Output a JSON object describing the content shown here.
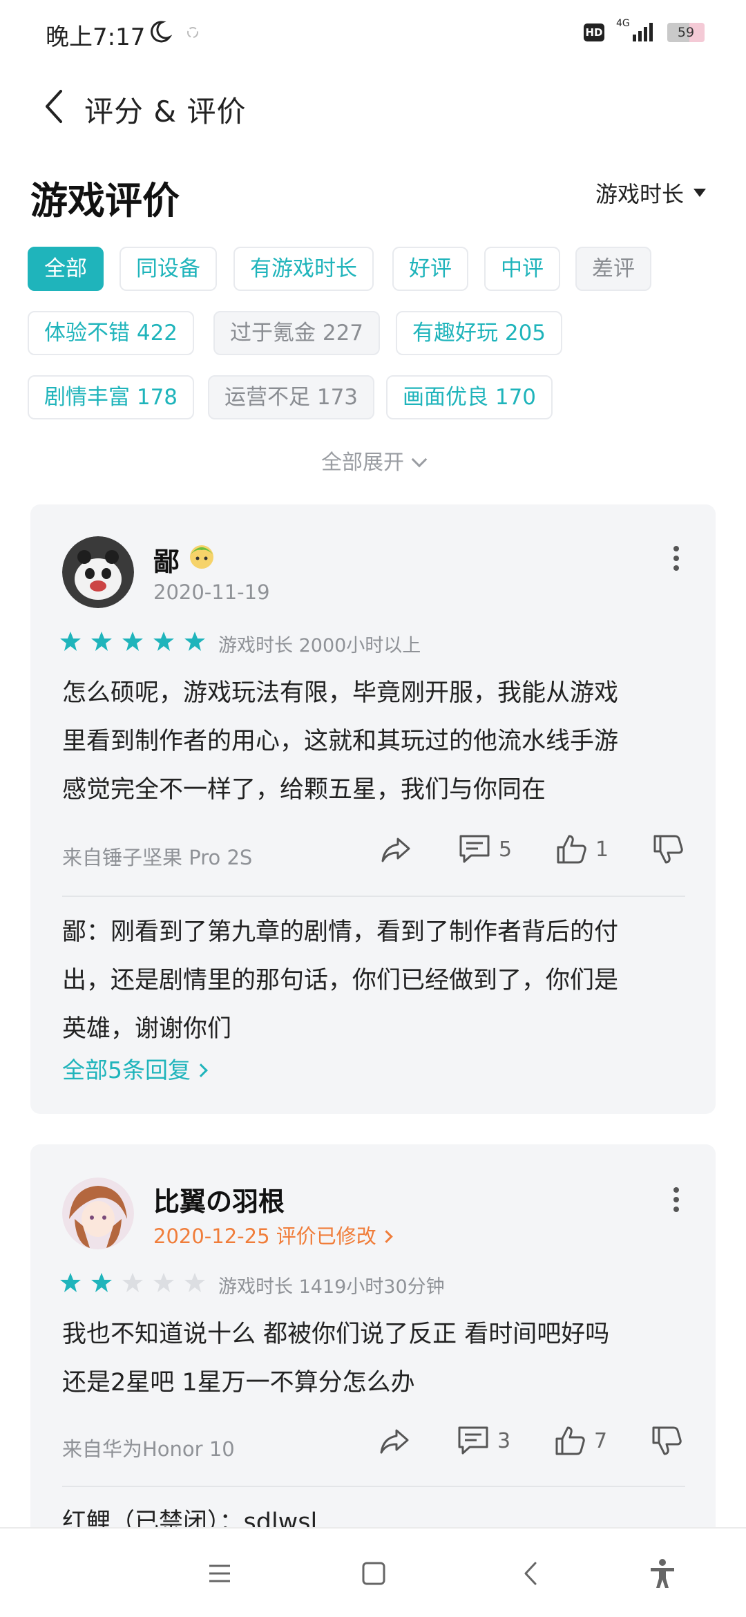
{
  "status_bar": {
    "time": "晚上7:17",
    "hd": "HD",
    "network": "4G",
    "battery": "59"
  },
  "header": {
    "title": "评分 & 评价"
  },
  "section": {
    "title": "游戏评价",
    "sort_label": "游戏时长"
  },
  "filters": [
    {
      "label": "全部",
      "state": "active"
    },
    {
      "label": "同设备",
      "state": "normal"
    },
    {
      "label": "有游戏时长",
      "state": "normal"
    },
    {
      "label": "好评",
      "state": "normal"
    },
    {
      "label": "中评",
      "state": "normal"
    },
    {
      "label": "差评",
      "state": "neg"
    },
    {
      "label": "体验不错 422",
      "state": "normal"
    },
    {
      "label": "过于氪金 227",
      "state": "neg"
    },
    {
      "label": "有趣好玩 205",
      "state": "normal"
    },
    {
      "label": "剧情丰富 178",
      "state": "normal"
    },
    {
      "label": "运营不足 173",
      "state": "neg"
    },
    {
      "label": "画面优良 170",
      "state": "normal"
    }
  ],
  "expand_all": "全部展开",
  "reviews": [
    {
      "user": "鄙",
      "date": "2020-11-19",
      "rating": 5,
      "playtime": "游戏时长 2000小时以上",
      "body_lines": [
        "怎么硕呢，游戏玩法有限，毕竟刚开服，我能从游戏",
        "里看到制作者的用心，这就和其玩过的他流水线手游",
        "感觉完全不一样了，给颗五星，我们与你同在"
      ],
      "source": "来自锤子坚果 Pro 2S",
      "comments": "5",
      "likes": "1",
      "reply_lines": [
        "鄙：刚看到了第九章的剧情，看到了制作者背后的付",
        "出，还是剧情里的那句话，你们已经做到了，你们是",
        "英雄，谢谢你们"
      ],
      "all_replies": "全部5条回复"
    },
    {
      "user": "比翼の羽根",
      "date": "2020-12-25 评价已修改",
      "rating": 2,
      "playtime": "游戏时长 1419小时30分钟",
      "body_lines": [
        "我也不知道说十么 都被你们说了反正 看时间吧好吗",
        "还是2星吧 1星万一不算分怎么办"
      ],
      "source": "来自华为Honor 10",
      "comments": "3",
      "likes": "7",
      "reply_lines": [
        "红鲤（已禁闭）：sdlwsl"
      ]
    }
  ],
  "colors": {
    "accent": "#1fb4bb",
    "edited": "#f07d3a",
    "card_bg": "#f4f5f7"
  }
}
